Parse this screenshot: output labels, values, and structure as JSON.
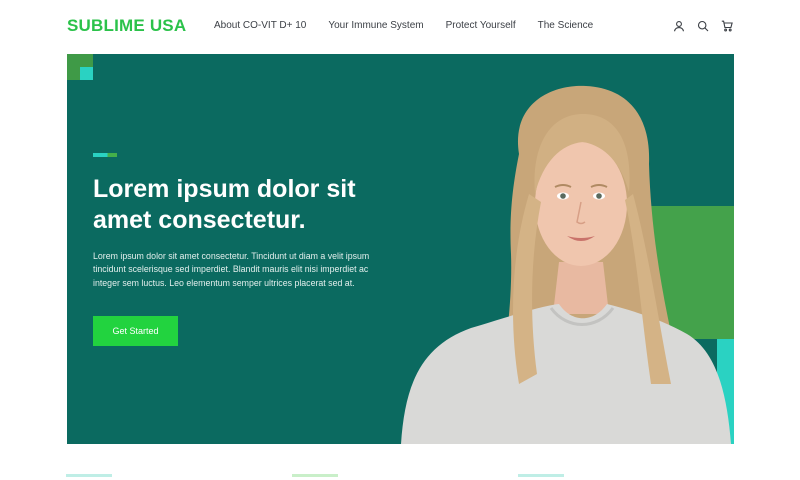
{
  "header": {
    "logo": "SUBLIME USA",
    "nav": [
      {
        "label": "About CO-VIT D+ 10"
      },
      {
        "label": "Your Immune System"
      },
      {
        "label": "Protect Yourself"
      },
      {
        "label": "The Science"
      }
    ],
    "icons": [
      "user-icon",
      "search-icon",
      "cart-icon"
    ]
  },
  "hero": {
    "title": "Lorem ipsum dolor sit amet consectetur.",
    "text": "Lorem ipsum dolor sit amet consectetur. Tincidunt ut diam a velit ipsum tincidunt scelerisque sed imperdiet. Blandit mauris elit nisi imperdiet ac integer sem luctus. Leo elementum semper ultrices placerat sed at.",
    "cta": "Get Started"
  },
  "colors": {
    "brand": "#2bc24a",
    "hero_bg": "#0b6a60",
    "accent_green": "#44a24b",
    "accent_teal": "#2ad2c2",
    "button": "#22d33f"
  }
}
